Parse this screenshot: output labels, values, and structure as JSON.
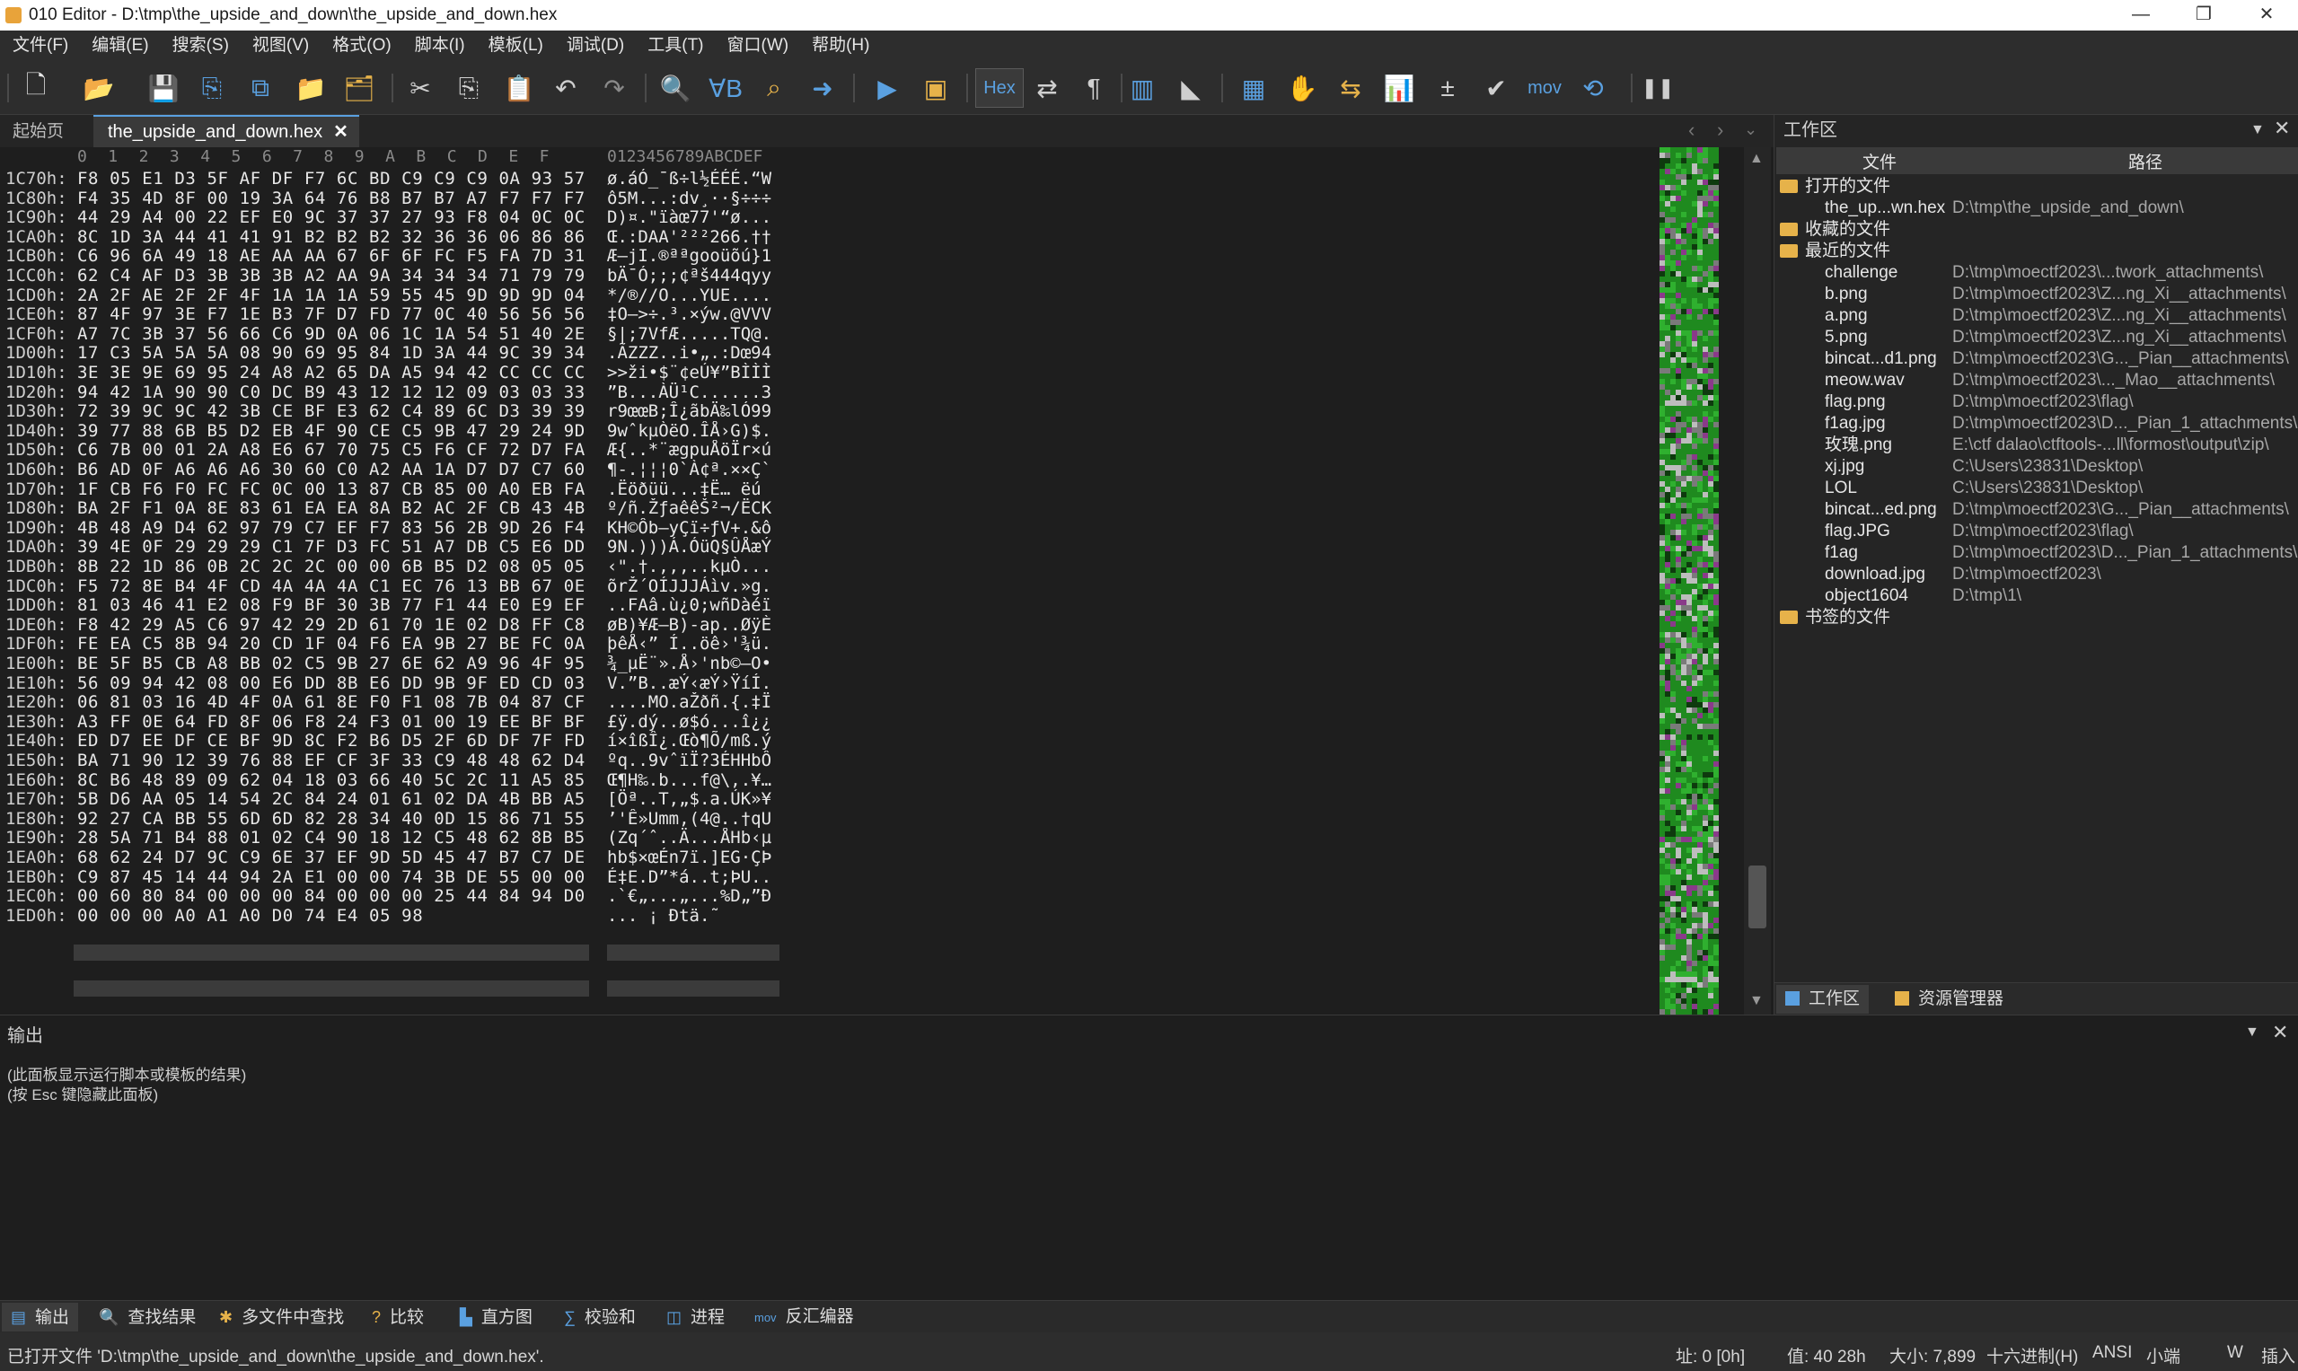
{
  "window": {
    "title": "010 Editor - D:\\tmp\\the_upside_and_down\\the_upside_and_down.hex",
    "minimize": "—",
    "maximize": "❐",
    "close": "✕"
  },
  "menu": [
    "文件(F)",
    "编辑(E)",
    "搜索(S)",
    "视图(V)",
    "格式(O)",
    "脚本(I)",
    "模板(L)",
    "调试(D)",
    "工具(T)",
    "窗口(W)",
    "帮助(H)"
  ],
  "toolbar": {
    "hex_label": "Hex",
    "mov_label": "mov",
    "icons": [
      "new-file-icon",
      "open-file-icon",
      "save-icon",
      "save-as-icon",
      "save-all-icon",
      "open-folder-icon",
      "open-multiple-icon",
      "cut-icon",
      "copy-icon",
      "paste-icon",
      "undo-icon",
      "redo-icon",
      "find-icon",
      "replace-icon",
      "find-in-files-icon",
      "goto-icon",
      "run-script-icon",
      "run-template-icon",
      "hex-mode-icon",
      "edit-as-icon",
      "show-whitespace-icon",
      "columns-icon",
      "highlight-icon",
      "calculator-icon",
      "inspector-icon",
      "compare-icon",
      "histogram-icon",
      "base-converter-icon",
      "checksum-icon",
      "disassembler-icon",
      "converter-icon",
      "pause-icon"
    ]
  },
  "tabs": {
    "start": "起始页",
    "file": "the_upside_and_down.hex",
    "close": "✕"
  },
  "hex": {
    "header_cols": "0  1  2  3  4  5  6  7  8  9  A  B  C  D  E  F",
    "header_ascii": "0123456789ABCDEF",
    "rows": [
      {
        "addr": "1C70h:",
        "bytes": "F8 05 E1 D3 5F AF DF F7 6C BD C9 C9 C9 0A 93 57",
        "ascii": "ø.áÓ_¯ß÷l½ÉÉÉ.“W"
      },
      {
        "addr": "1C80h:",
        "bytes": "F4 35 4D 8F 00 19 3A 64 76 B8 B7 B7 A7 F7 F7 F7",
        "ascii": "ô5M...:dv¸··§÷÷÷"
      },
      {
        "addr": "1C90h:",
        "bytes": "44 29 A4 00 22 EF E0 9C 37 37 27 93 F8 04 0C 0C",
        "ascii": "D)¤.\"ïàœ77'“ø..."
      },
      {
        "addr": "1CA0h:",
        "bytes": "8C 1D 3A 44 41 41 91 B2 B2 B2 32 36 36 06 86 86",
        "ascii": "Œ.:DAA'²²²266.††"
      },
      {
        "addr": "1CB0h:",
        "bytes": "C6 96 6A 49 18 AE AA AA 67 6F 6F FC F5 FA 7D 31",
        "ascii": "Æ–jI.®ªªgooüõú}1"
      },
      {
        "addr": "1CC0h:",
        "bytes": "62 C4 AF D3 3B 3B 3B A2 AA 9A 34 34 34 71 79 79",
        "ascii": "bÄ¯Ó;;;¢ªš444qyy"
      },
      {
        "addr": "1CD0h:",
        "bytes": "2A 2F AE 2F 2F 4F 1A 1A 1A 59 55 45 9D 9D 9D 04",
        "ascii": "*/®//O...YUE...."
      },
      {
        "addr": "1CE0h:",
        "bytes": "87 4F 97 3E F7 1E B3 7F D7 FD 77 0C 40 56 56 56",
        "ascii": "‡O—>÷.³.×ýw.@VVV"
      },
      {
        "addr": "1CF0h:",
        "bytes": "A7 7C 3B 37 56 66 C6 9D 0A 06 1C 1A 54 51 40 2E",
        "ascii": "§|;7VfÆ.....TQ@."
      },
      {
        "addr": "1D00h:",
        "bytes": "17 C3 5A 5A 5A 08 90 69 95 84 1D 3A 44 9C 39 34",
        "ascii": ".ÃZZZ..i•„.:Dœ94"
      },
      {
        "addr": "1D10h:",
        "bytes": "3E 3E 9E 69 95 24 A8 A2 65 DA A5 94 42 CC CC CC",
        "ascii": ">>ži•$¨¢eÚ¥”BÌÌÌ"
      },
      {
        "addr": "1D20h:",
        "bytes": "94 42 1A 90 90 C0 DC B9 43 12 12 12 09 03 03 33",
        "ascii": "”B...ÀÜ¹C......3"
      },
      {
        "addr": "1D30h:",
        "bytes": "72 39 9C 9C 42 3B CE BF E3 62 C4 89 6C D3 39 39",
        "ascii": "r9œœB;Î¿ãbÄ‰lÓ99"
      },
      {
        "addr": "1D40h:",
        "bytes": "39 77 88 6B B5 D2 EB 4F 90 CE C5 9B 47 29 24 9D",
        "ascii": "9wˆkµÒëO.ÎÅ›G)$."
      },
      {
        "addr": "1D50h:",
        "bytes": "C6 7B 00 01 2A A8 E6 67 70 75 C5 F6 CF 72 D7 FA",
        "ascii": "Æ{..*¨ægpuÅöÏr×ú"
      },
      {
        "addr": "1D60h:",
        "bytes": "B6 AD 0F A6 A6 A6 30 60 C0 A2 AA 1A D7 D7 C7 60",
        "ascii": "¶-.¦¦¦0`À¢ª.××Ç`"
      },
      {
        "addr": "1D70h:",
        "bytes": "1F CB F6 F0 FC FC 0C 00 13 87 CB 85 00 A0 EB FA",
        "ascii": ".Ëöðüü...‡Ë… ëú"
      },
      {
        "addr": "1D80h:",
        "bytes": "BA 2F F1 0A 8E 83 61 EA EA 8A B2 AC 2F CB 43 4B",
        "ascii": "º/ñ.ŽƒaêêŠ²¬/ËCK"
      },
      {
        "addr": "1D90h:",
        "bytes": "4B 48 A9 D4 62 97 79 C7 EF F7 83 56 2B 9D 26 F4",
        "ascii": "KH©Ôb—yÇï÷ƒV+.&ô"
      },
      {
        "addr": "1DA0h:",
        "bytes": "39 4E 0F 29 29 29 C1 7F D3 FC 51 A7 DB C5 E6 DD",
        "ascii": "9N.)))Á.ÓüQ§ÛÅæÝ"
      },
      {
        "addr": "1DB0h:",
        "bytes": "8B 22 1D 86 0B 2C 2C 2C 00 00 6B B5 D2 08 05 05",
        "ascii": "‹\".†.,,,..kµÒ..."
      },
      {
        "addr": "1DC0h:",
        "bytes": "F5 72 8E B4 4F CD 4A 4A 4A C1 EC 76 13 BB 67 0E",
        "ascii": "õrŽ´OÍJJJÁìv.»g."
      },
      {
        "addr": "1DD0h:",
        "bytes": "81 03 46 41 E2 08 F9 BF 30 3B 77 F1 44 E0 E9 EF",
        "ascii": "..FAâ.ù¿0;wñDàéï"
      },
      {
        "addr": "1DE0h:",
        "bytes": "F8 42 29 A5 C6 97 42 29 2D 61 70 1E 02 D8 FF C8",
        "ascii": "øB)¥Æ—B)-ap..ØÿÈ"
      },
      {
        "addr": "1DF0h:",
        "bytes": "FE EA C5 8B 94 20 CD 1F 04 F6 EA 9B 27 BE FC 0A",
        "ascii": "þêÅ‹” Í..öê›'¾ü."
      },
      {
        "addr": "1E00h:",
        "bytes": "BE 5F B5 CB A8 BB 02 C5 9B 27 6E 62 A9 96 4F 95",
        "ascii": "¾_µË¨».Å›'nb©–O•"
      },
      {
        "addr": "1E10h:",
        "bytes": "56 09 94 42 08 00 E6 DD 8B E6 DD 9B 9F ED CD 03",
        "ascii": "V.”B..æÝ‹æÝ›ŸíÍ."
      },
      {
        "addr": "1E20h:",
        "bytes": "06 81 03 16 4D 4F 0A 61 8E F0 F1 08 7B 04 87 CF",
        "ascii": "....MO.aŽðñ.{.‡Ï"
      },
      {
        "addr": "1E30h:",
        "bytes": "A3 FF 0E 64 FD 8F 06 F8 24 F3 01 00 19 EE BF BF",
        "ascii": "£ÿ.dý..ø$ó...î¿¿"
      },
      {
        "addr": "1E40h:",
        "bytes": "ED D7 EE DF CE BF 9D 8C F2 B6 D5 2F 6D DF 7F FD",
        "ascii": "í×îßÎ¿.Œò¶Õ/mß.ý"
      },
      {
        "addr": "1E50h:",
        "bytes": "BA 71 90 12 39 76 88 EF CF 3F 33 C9 48 48 62 D4",
        "ascii": "ºq..9vˆïÏ?3ÉHHbÔ"
      },
      {
        "addr": "1E60h:",
        "bytes": "8C B6 48 89 09 62 04 18 03 66 40 5C 2C 11 A5 85",
        "ascii": "Œ¶H‰.b...f@\\,.¥…"
      },
      {
        "addr": "1E70h:",
        "bytes": "5B D6 AA 05 14 54 2C 84 24 01 61 02 DA 4B BB A5",
        "ascii": "[Öª..T,„$.a.ÚK»¥"
      },
      {
        "addr": "1E80h:",
        "bytes": "92 27 CA BB 55 6D 6D 82 28 34 40 0D 15 86 71 55",
        "ascii": "’'Ê»Umm‚(4@..†qU"
      },
      {
        "addr": "1E90h:",
        "bytes": "28 5A 71 B4 88 01 02 C4 90 18 12 C5 48 62 8B B5",
        "ascii": "(Zq´ˆ..Ä...ÅHb‹µ"
      },
      {
        "addr": "1EA0h:",
        "bytes": "68 62 24 D7 9C C9 6E 37 EF 9D 5D 45 47 B7 C7 DE",
        "ascii": "hb$×œÉn7ï.]EG·ÇÞ"
      },
      {
        "addr": "1EB0h:",
        "bytes": "C9 87 45 14 44 94 2A E1 00 00 74 3B DE 55 00 00",
        "ascii": "É‡E.D”*á..t;ÞU.."
      },
      {
        "addr": "1EC0h:",
        "bytes": "00 60 80 84 00 00 00 84 00 00 00 25 44 84 94 D0",
        "ascii": ".`€„...„...%D„”Ð"
      },
      {
        "addr": "1ED0h:",
        "bytes": "00 00 00 A0 A1 A0 D0 74 E4 05 98",
        "ascii": "... ¡ Ðtä.˜"
      }
    ]
  },
  "workspace": {
    "title": "工作区",
    "col_file": "文件",
    "col_path": "路径",
    "open_files_label": "打开的文件",
    "open_files": [
      {
        "name": "the_up...wn.hex",
        "path": "D:\\tmp\\the_upside_and_down\\"
      }
    ],
    "favorites_label": "收藏的文件",
    "recent_label": "最近的文件",
    "recent": [
      {
        "name": "challenge",
        "path": "D:\\tmp\\moectf2023\\...twork_attachments\\"
      },
      {
        "name": "b.png",
        "path": "D:\\tmp\\moectf2023\\Z...ng_Xi__attachments\\"
      },
      {
        "name": "a.png",
        "path": "D:\\tmp\\moectf2023\\Z...ng_Xi__attachments\\"
      },
      {
        "name": "5.png",
        "path": "D:\\tmp\\moectf2023\\Z...ng_Xi__attachments\\"
      },
      {
        "name": "bincat...d1.png",
        "path": "D:\\tmp\\moectf2023\\G..._Pian__attachments\\"
      },
      {
        "name": "meow.wav",
        "path": "D:\\tmp\\moectf2023\\..._Mao__attachments\\"
      },
      {
        "name": "flag.png",
        "path": "D:\\tmp\\moectf2023\\flag\\"
      },
      {
        "name": "f1ag.jpg",
        "path": "D:\\tmp\\moectf2023\\D..._Pian_1_attachments\\"
      },
      {
        "name": "玫瑰.png",
        "path": "E:\\ctf dalao\\ctftools-...ll\\formost\\output\\zip\\"
      },
      {
        "name": "xj.jpg",
        "path": "C:\\Users\\23831\\Desktop\\"
      },
      {
        "name": "LOL",
        "path": "C:\\Users\\23831\\Desktop\\"
      },
      {
        "name": "bincat...ed.png",
        "path": "D:\\tmp\\moectf2023\\G..._Pian__attachments\\"
      },
      {
        "name": "flag.JPG",
        "path": "D:\\tmp\\moectf2023\\flag\\"
      },
      {
        "name": "f1ag",
        "path": "D:\\tmp\\moectf2023\\D..._Pian_1_attachments\\"
      },
      {
        "name": "download.jpg",
        "path": "D:\\tmp\\moectf2023\\"
      },
      {
        "name": "object1604",
        "path": "D:\\tmp\\1\\"
      }
    ],
    "bookmarks_label": "书签的文件",
    "tab_workspace": "工作区",
    "tab_explorer": "资源管理器"
  },
  "output": {
    "title": "输出",
    "lines": [
      "(此面板显示运行脚本或模板的结果)",
      "(按 Esc 键隐藏此面板)"
    ]
  },
  "bottom_tabs": [
    "输出",
    "查找结果",
    "多文件中查找",
    "比较",
    "直方图",
    "校验和",
    "进程",
    "反汇编器"
  ],
  "status": {
    "message": "已打开文件 'D:\\tmp\\the_upside_and_down\\the_upside_and_down.hex'.",
    "address": "址: 0 [0h]",
    "value": "值: 40 28h",
    "size": "大小: 7,899",
    "mode": "十六进制(H)",
    "encoding": "ANSI",
    "endian": "小端",
    "w": "W",
    "insert": "插入"
  }
}
